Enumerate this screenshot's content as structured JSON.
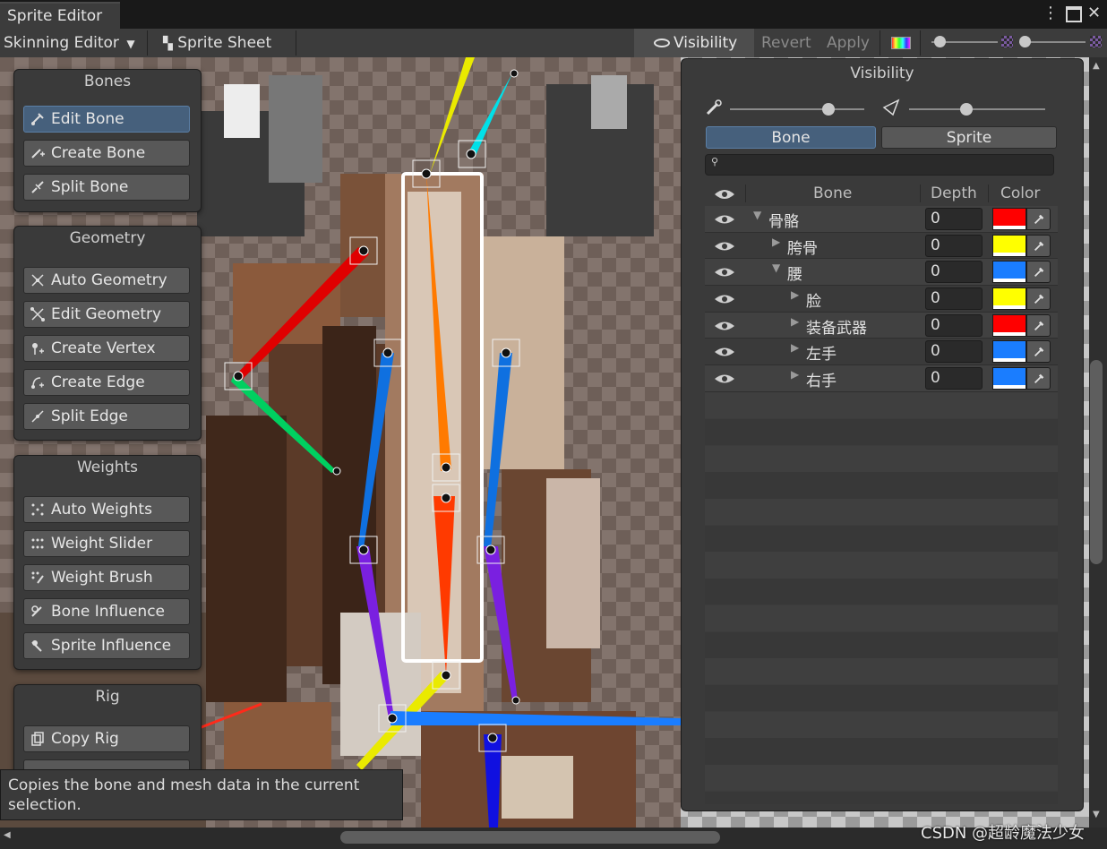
{
  "window": {
    "tab_title": "Sprite Editor",
    "menu_icon": "kebab-menu-icon",
    "maximize_icon": "maximize-icon",
    "close_icon": "close-icon"
  },
  "toolbar": {
    "mode_dropdown": "Skinning Editor",
    "sprite_sheet": "Sprite Sheet",
    "visibility": "Visibility",
    "revert": "Revert",
    "apply": "Apply"
  },
  "panels": {
    "bones": {
      "title": "Bones",
      "tools": [
        "Edit Bone",
        "Create Bone",
        "Split Bone"
      ],
      "active": "Edit Bone"
    },
    "geometry": {
      "title": "Geometry",
      "tools": [
        "Auto Geometry",
        "Edit Geometry",
        "Create Vertex",
        "Create Edge",
        "Split Edge"
      ]
    },
    "weights": {
      "title": "Weights",
      "tools": [
        "Auto Weights",
        "Weight Slider",
        "Weight Brush",
        "Bone Influence",
        "Sprite Influence"
      ]
    },
    "rig": {
      "title": "Rig",
      "tools": [
        "Copy Rig"
      ]
    }
  },
  "tooltip": "Copies the bone and mesh data in the current selection.",
  "visibility_panel": {
    "title": "Visibility",
    "bone_opacity": 0.73,
    "sprite_opacity": 0.42,
    "tabs": [
      "Bone",
      "Sprite"
    ],
    "active_tab": "Bone",
    "search_placeholder": "",
    "columns": {
      "bone": "Bone",
      "depth": "Depth",
      "color": "Color"
    },
    "rows": [
      {
        "name": "骨骼",
        "depth": "0",
        "color": "#ff0000",
        "indent": 0,
        "expanded": true
      },
      {
        "name": "胯骨",
        "depth": "0",
        "color": "#ffff00",
        "indent": 1,
        "expanded": false
      },
      {
        "name": "腰",
        "depth": "0",
        "color": "#1a7dff",
        "indent": 1,
        "expanded": true
      },
      {
        "name": "脸",
        "depth": "0",
        "color": "#ffff00",
        "indent": 2,
        "expanded": false
      },
      {
        "name": "装备武器",
        "depth": "0",
        "color": "#ff0000",
        "indent": 2,
        "expanded": false
      },
      {
        "name": "左手",
        "depth": "0",
        "color": "#1a7dff",
        "indent": 2,
        "expanded": false
      },
      {
        "name": "右手",
        "depth": "0",
        "color": "#1a7dff",
        "indent": 2,
        "expanded": false
      }
    ]
  },
  "watermark": "CSDN @超龄魔法少女"
}
